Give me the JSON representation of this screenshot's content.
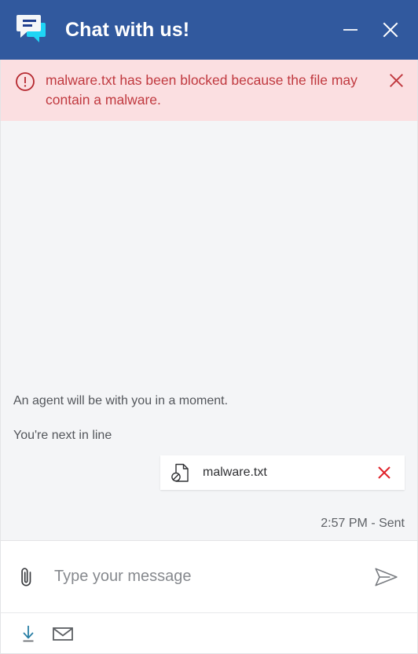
{
  "header": {
    "title": "Chat with us!",
    "icon": "chat-bubbles-icon",
    "background_color": "#31599e",
    "minimize_label": "Minimize",
    "close_label": "Close"
  },
  "alert": {
    "icon": "exclamation-circle-icon",
    "message": "malware.txt has been blocked because the file may contain a malware.",
    "close_label": "Dismiss",
    "background_color": "#fbdfe1",
    "text_color": "#c0393f"
  },
  "messages": [
    {
      "type": "system",
      "text": "An agent will be with you in a moment."
    },
    {
      "type": "system",
      "text": "You're next in line"
    }
  ],
  "attachment": {
    "icon": "blocked-file-icon",
    "filename": "malware.txt",
    "remove_label": "Remove attachment",
    "remove_color": "#e0222a"
  },
  "status": {
    "text": "2:57 PM - Sent"
  },
  "composer": {
    "attach_label": "Attach file",
    "attach_icon": "paperclip-icon",
    "input_value": "",
    "input_placeholder": "Type your message",
    "send_label": "Send",
    "send_icon": "paper-plane-icon"
  },
  "footer": {
    "download_label": "Download transcript",
    "download_icon": "download-icon",
    "download_color": "#2a7fa5",
    "email_label": "Email transcript",
    "email_icon": "envelope-icon"
  }
}
